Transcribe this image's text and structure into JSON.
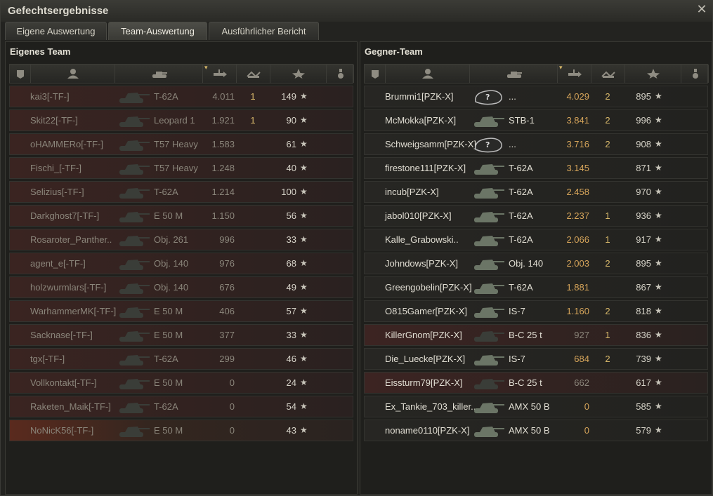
{
  "window": {
    "title": "Gefechtsergebnisse"
  },
  "tabs": [
    {
      "label": "Eigene Auswertung",
      "active": false
    },
    {
      "label": "Team-Auswertung",
      "active": true
    },
    {
      "label": "Ausführlicher Bericht",
      "active": false
    }
  ],
  "own_team": {
    "title": "Eigenes Team",
    "rows": [
      {
        "name": "kai3[-TF-]",
        "tank": "T-62A",
        "damage": "4.011",
        "frags": "1",
        "xp": "149",
        "dead": true
      },
      {
        "name": "Skit22[-TF-]",
        "tank": "Leopard 1",
        "damage": "1.921",
        "frags": "1",
        "xp": "90",
        "dead": true
      },
      {
        "name": "oHAMMERo[-TF-]",
        "tank": "T57 Heavy",
        "damage": "1.583",
        "frags": "",
        "xp": "61",
        "dead": true
      },
      {
        "name": "Fischi_[-TF-]",
        "tank": "T57 Heavy",
        "damage": "1.248",
        "frags": "",
        "xp": "40",
        "dead": true
      },
      {
        "name": "Selizius[-TF-]",
        "tank": "T-62A",
        "damage": "1.214",
        "frags": "",
        "xp": "100",
        "dead": true
      },
      {
        "name": "Darkghost7[-TF-]",
        "tank": "E 50 M",
        "damage": "1.150",
        "frags": "",
        "xp": "56",
        "dead": true
      },
      {
        "name": "Rosaroter_Panther..",
        "tank": "Obj. 261",
        "damage": "996",
        "frags": "",
        "xp": "33",
        "dead": true
      },
      {
        "name": "agent_e[-TF-]",
        "tank": "Obj. 140",
        "damage": "976",
        "frags": "",
        "xp": "68",
        "dead": true
      },
      {
        "name": "holzwurmlars[-TF-]",
        "tank": "Obj. 140",
        "damage": "676",
        "frags": "",
        "xp": "49",
        "dead": true
      },
      {
        "name": "WarhammerMK[-TF-]",
        "tank": "E 50 M",
        "damage": "406",
        "frags": "",
        "xp": "57",
        "dead": true
      },
      {
        "name": "Sacknase[-TF-]",
        "tank": "E 50 M",
        "damage": "377",
        "frags": "",
        "xp": "33",
        "dead": true
      },
      {
        "name": "tgx[-TF-]",
        "tank": "T-62A",
        "damage": "299",
        "frags": "",
        "xp": "46",
        "dead": true
      },
      {
        "name": "Vollkontakt[-TF-]",
        "tank": "E 50 M",
        "damage": "0",
        "frags": "",
        "xp": "24",
        "dead": true
      },
      {
        "name": "Raketen_Maik[-TF-]",
        "tank": "T-62A",
        "damage": "0",
        "frags": "",
        "xp": "54",
        "dead": true
      },
      {
        "name": "NoNicK56[-TF-]",
        "tank": "E 50 M",
        "damage": "0",
        "frags": "",
        "xp": "43",
        "dead": true,
        "player": true
      }
    ]
  },
  "enemy_team": {
    "title": "Gegner-Team",
    "rows": [
      {
        "name": "Brummi1[PZK-X]",
        "tank": "...",
        "damage": "4.029",
        "frags": "2",
        "xp": "895",
        "dead": false,
        "unknown": true
      },
      {
        "name": "McMokka[PZK-X]",
        "tank": "STB-1",
        "damage": "3.841",
        "frags": "2",
        "xp": "996",
        "dead": false
      },
      {
        "name": "Schweigsamm[PZK-X]",
        "tank": "...",
        "damage": "3.716",
        "frags": "2",
        "xp": "908",
        "dead": false,
        "unknown": true
      },
      {
        "name": "firestone111[PZK-X]",
        "tank": "T-62A",
        "damage": "3.145",
        "frags": "",
        "xp": "871",
        "dead": false
      },
      {
        "name": "incub[PZK-X]",
        "tank": "T-62A",
        "damage": "2.458",
        "frags": "",
        "xp": "970",
        "dead": false
      },
      {
        "name": "jabol010[PZK-X]",
        "tank": "T-62A",
        "damage": "2.237",
        "frags": "1",
        "xp": "936",
        "dead": false
      },
      {
        "name": "Kalle_Grabowski..",
        "tank": "T-62A",
        "damage": "2.066",
        "frags": "1",
        "xp": "917",
        "dead": false
      },
      {
        "name": "Johndows[PZK-X]",
        "tank": "Obj. 140",
        "damage": "2.003",
        "frags": "2",
        "xp": "895",
        "dead": false
      },
      {
        "name": "Greengobelin[PZK-X]",
        "tank": "T-62A",
        "damage": "1.881",
        "frags": "",
        "xp": "867",
        "dead": false
      },
      {
        "name": "O815Gamer[PZK-X]",
        "tank": "IS-7",
        "damage": "1.160",
        "frags": "2",
        "xp": "818",
        "dead": false
      },
      {
        "name": "KillerGnom[PZK-X]",
        "tank": "B-C 25 t",
        "damage": "927",
        "frags": "1",
        "xp": "836",
        "dead": true
      },
      {
        "name": "Die_Luecke[PZK-X]",
        "tank": "IS-7",
        "damage": "684",
        "frags": "2",
        "xp": "739",
        "dead": false
      },
      {
        "name": "Eissturm79[PZK-X]",
        "tank": "B-C 25 t",
        "damage": "662",
        "frags": "",
        "xp": "617",
        "dead": true
      },
      {
        "name": "Ex_Tankie_703_killer..",
        "tank": "AMX 50 B",
        "damage": "0",
        "frags": "",
        "xp": "585",
        "dead": false
      },
      {
        "name": "noname0110[PZK-X]",
        "tank": "AMX 50 B",
        "damage": "0",
        "frags": "",
        "xp": "579",
        "dead": false
      }
    ]
  },
  "columns": [
    {
      "icon": "squad-icon"
    },
    {
      "icon": "player-icon"
    },
    {
      "icon": "tank-icon"
    },
    {
      "icon": "damage-icon"
    },
    {
      "icon": "frags-icon"
    },
    {
      "icon": "xp-star-icon"
    },
    {
      "icon": "medal-icon"
    }
  ],
  "star_glyph": "★"
}
